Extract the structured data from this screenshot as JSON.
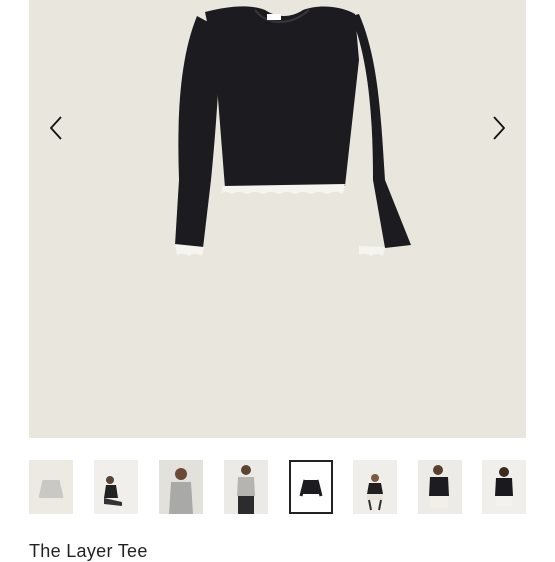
{
  "product": {
    "title": "The Layer Tee"
  },
  "gallery": {
    "prev_icon": "chevron-left-icon",
    "next_icon": "chevron-right-icon",
    "selected_thumbnail": 5,
    "thumbnail_count": 8
  },
  "colors": {
    "image_background": "#e9e6dd",
    "garment": "#1c1b20",
    "trim": "#f6f4ef"
  }
}
